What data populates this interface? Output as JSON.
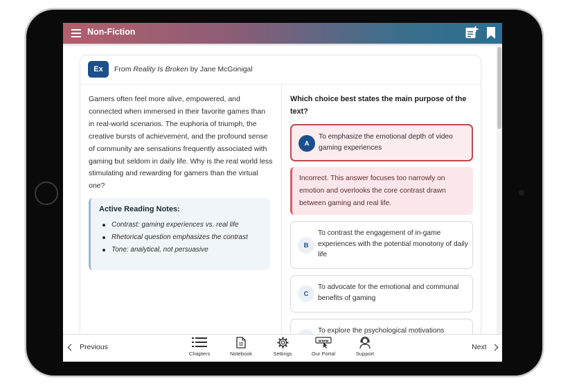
{
  "header": {
    "title": "Non-Fiction",
    "menu_icon": "hamburger-menu-icon",
    "actions": [
      "add-note-icon",
      "bookmark-icon"
    ]
  },
  "excerpt": {
    "badge": "Ex",
    "source_prefix": "From ",
    "source_title": "Reality Is Broken",
    "source_suffix": " by Jane McGonigal",
    "passage": "Gamers often feel more alive, empowered, and connected when immersed in their favorite games than in real-world scenarios. The euphoria of triumph, the creative bursts of achievement, and the profound sense of community are sensations frequently associated with gaming but seldom in daily life. Why is the real world less stimulating and rewarding for gamers than the virtual one?"
  },
  "notes": {
    "title": "Active Reading Notes:",
    "items": [
      "Contrast: gaming experiences vs. real life",
      "Rhetorical question emphasizes the contrast",
      "Tone: analytical, not persuasive"
    ]
  },
  "question": {
    "prompt": "Which choice best states the main purpose of the text?",
    "selected": "A",
    "choices": [
      {
        "letter": "A",
        "text": "To emphasize the emotional depth of video gaming experiences"
      },
      {
        "letter": "B",
        "text": "To contrast the engagement of in-game experiences with the potential monotony of daily life"
      },
      {
        "letter": "C",
        "text": "To advocate for the emotional and communal benefits of gaming"
      },
      {
        "letter": "D",
        "text": "To explore the psychological motivations"
      }
    ],
    "feedback": "Incorrect. This answer focuses too narrowly on emotion and overlooks the core contrast drawn between gaming and real life."
  },
  "bottom_nav": {
    "previous": "Previous",
    "next": "Next",
    "items": [
      {
        "label": "Chapters",
        "icon": "list-icon"
      },
      {
        "label": "Notebook",
        "icon": "notebook-icon"
      },
      {
        "label": "Settings",
        "icon": "gear-icon"
      },
      {
        "label": "Our Portal",
        "icon": "www-portal-icon"
      },
      {
        "label": "Support",
        "icon": "support-agent-icon"
      }
    ]
  },
  "colors": {
    "header_gradient_start": "#b35e6c",
    "header_gradient_end": "#2b6f92",
    "accent_blue": "#1b4f8a",
    "incorrect_red": "#c0464f",
    "feedback_bg": "#fbe7e9"
  }
}
